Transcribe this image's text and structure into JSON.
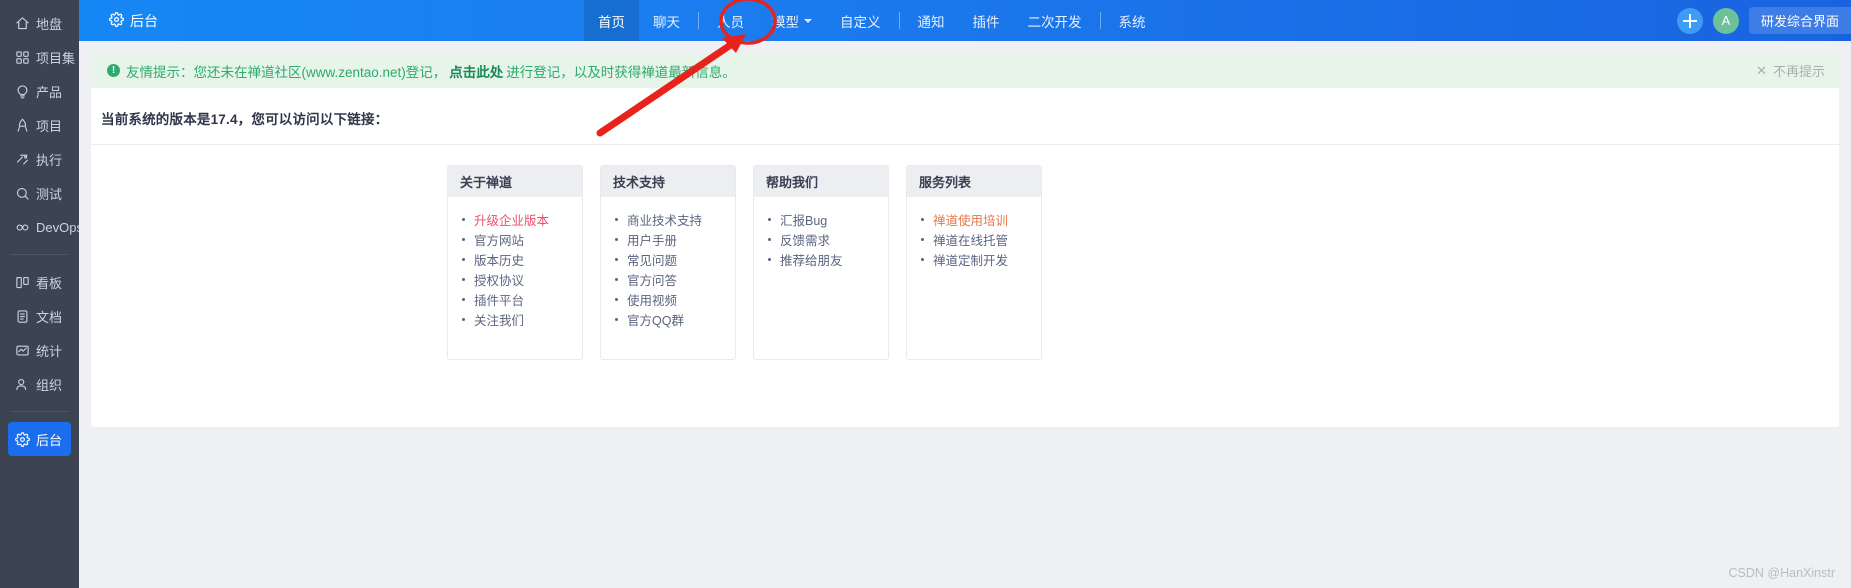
{
  "sidebar": {
    "items": [
      {
        "label": "地盘",
        "icon": "home-icon",
        "active": false
      },
      {
        "label": "项目集",
        "icon": "grid-icon",
        "active": false
      },
      {
        "label": "产品",
        "icon": "lightbulb-icon",
        "active": false
      },
      {
        "label": "项目",
        "icon": "rocket-icon",
        "active": false
      },
      {
        "label": "执行",
        "icon": "run-icon",
        "active": false
      },
      {
        "label": "测试",
        "icon": "search-circle-icon",
        "active": false
      },
      {
        "label": "DevOps",
        "icon": "infinity-icon",
        "active": false
      },
      {
        "label": "看板",
        "icon": "kanban-icon",
        "active": false
      },
      {
        "label": "文档",
        "icon": "document-icon",
        "active": false
      },
      {
        "label": "统计",
        "icon": "chart-icon",
        "active": false
      },
      {
        "label": "组织",
        "icon": "users-icon",
        "active": false
      },
      {
        "label": "后台",
        "icon": "gear-icon",
        "active": true
      }
    ]
  },
  "topbar": {
    "brand": "后台",
    "brand_icon": "gear-icon",
    "nav": [
      {
        "label": "首页",
        "active": true,
        "dropdown": false,
        "sep_after": false
      },
      {
        "label": "聊天",
        "active": false,
        "dropdown": false,
        "sep_after": true
      },
      {
        "label": "人员",
        "active": false,
        "dropdown": false,
        "sep_after": false
      },
      {
        "label": "模型",
        "active": false,
        "dropdown": true,
        "sep_after": false
      },
      {
        "label": "自定义",
        "active": false,
        "dropdown": false,
        "sep_after": true
      },
      {
        "label": "通知",
        "active": false,
        "dropdown": false,
        "sep_after": false
      },
      {
        "label": "插件",
        "active": false,
        "dropdown": false,
        "sep_after": false
      },
      {
        "label": "二次开发",
        "active": false,
        "dropdown": false,
        "sep_after": true
      },
      {
        "label": "系统",
        "active": false,
        "dropdown": false,
        "sep_after": false
      }
    ],
    "add_button_label": "+",
    "avatar_initial": "A",
    "workspace_label": "研发综合界面"
  },
  "notice": {
    "icon": "info-icon",
    "prefix": "友情提示：您还未在禅道社区(www.zentao.net)登记，",
    "link": "点击此处",
    "suffix": "进行登记，以及时获得禅道最新信息。",
    "dismiss_icon": "close-icon",
    "dismiss_label": "不再提示"
  },
  "main": {
    "version_line": "当前系统的版本是17.4，您可以访问以下链接：",
    "cards": [
      {
        "title": "关于禅道",
        "items": [
          {
            "label": "升级企业版本",
            "style": "danger"
          },
          {
            "label": "官方网站",
            "style": "normal"
          },
          {
            "label": "版本历史",
            "style": "normal"
          },
          {
            "label": "授权协议",
            "style": "normal"
          },
          {
            "label": "插件平台",
            "style": "normal"
          },
          {
            "label": "关注我们",
            "style": "normal"
          }
        ]
      },
      {
        "title": "技术支持",
        "items": [
          {
            "label": "商业技术支持",
            "style": "normal"
          },
          {
            "label": "用户手册",
            "style": "normal"
          },
          {
            "label": "常见问题",
            "style": "normal"
          },
          {
            "label": "官方问答",
            "style": "normal"
          },
          {
            "label": "使用视频",
            "style": "normal"
          },
          {
            "label": "官方QQ群",
            "style": "normal"
          }
        ]
      },
      {
        "title": "帮助我们",
        "items": [
          {
            "label": "汇报Bug",
            "style": "normal"
          },
          {
            "label": "反馈需求",
            "style": "normal"
          },
          {
            "label": "推荐给朋友",
            "style": "normal"
          }
        ]
      },
      {
        "title": "服务列表",
        "items": [
          {
            "label": "禅道使用培训",
            "style": "warn"
          },
          {
            "label": "禅道在线托管",
            "style": "normal"
          },
          {
            "label": "禅道定制开发",
            "style": "normal"
          }
        ]
      }
    ]
  },
  "annotation": {
    "highlight_target": "人员",
    "color": "#e8231c",
    "watermark": "CSDN @HanXinstr"
  }
}
